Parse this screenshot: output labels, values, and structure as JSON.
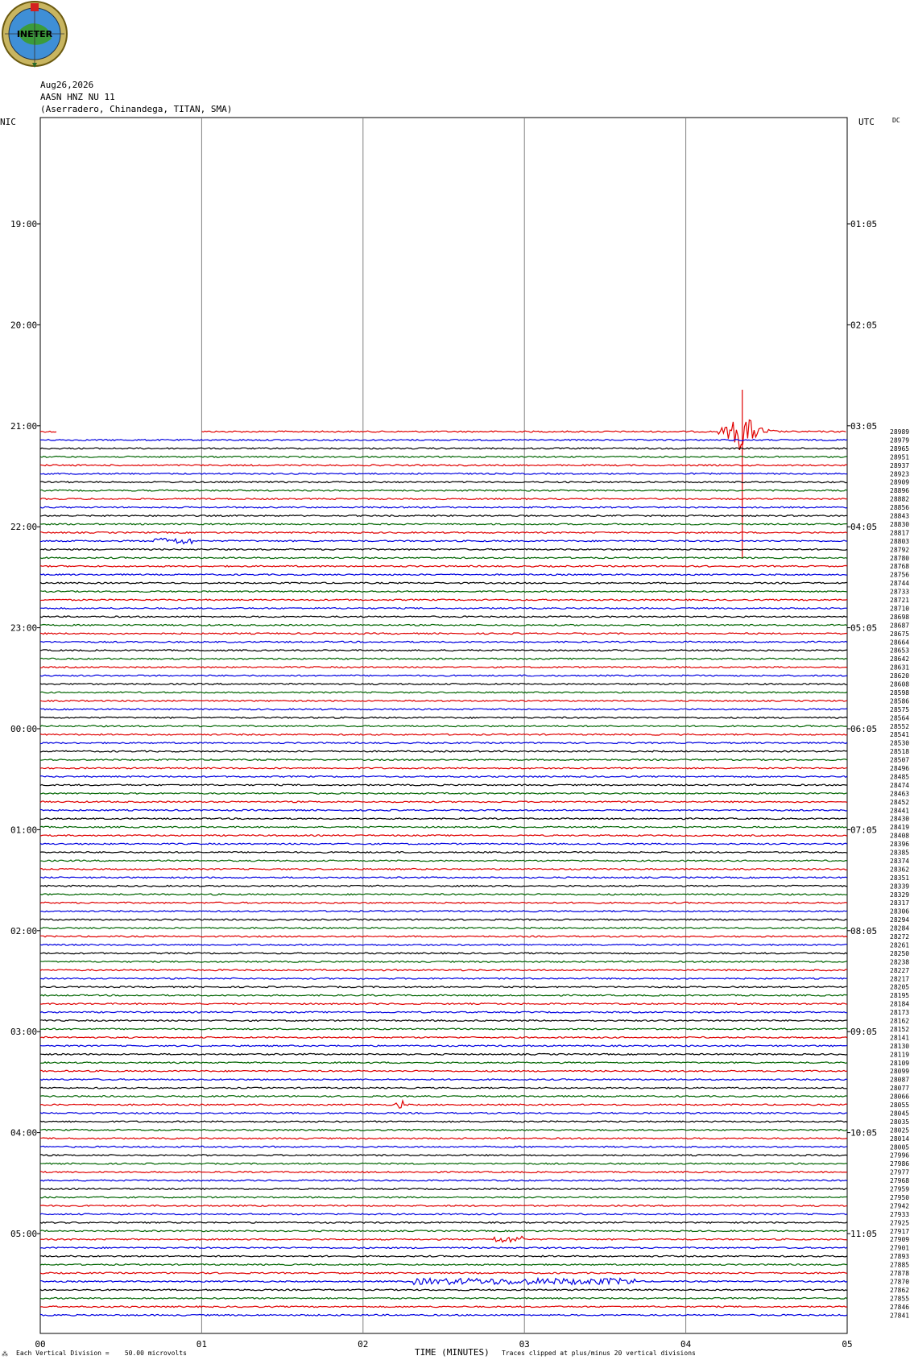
{
  "logo": {
    "text": "INETER"
  },
  "header": {
    "date": "Aug26,2026",
    "channel": "AASN HNZ NU 11",
    "location": "(Aserradero, Chinandega, TITAN, SMA)",
    "left_zone": "NIC",
    "right_zone": "UTC",
    "dc_label": "DC"
  },
  "footer": {
    "scale_note": "Each Vertical Division =    50.00 microvolts",
    "xlabel": "TIME (MINUTES)",
    "clip_note": "Traces clipped at plus/minus 20 vertical divisions"
  },
  "colors": {
    "red": "#e00000",
    "blue": "#0000e0",
    "black": "#000000",
    "green": "#006400"
  },
  "chart_data": {
    "type": "seismogram-helicorder",
    "x_ticks": [
      "00",
      "01",
      "02",
      "03",
      "04",
      "05"
    ],
    "xlim": [
      0,
      5
    ],
    "xlabel": "TIME (MINUTES)",
    "left_time_labels": [
      "19:00",
      "20:00",
      "21:00",
      "22:00",
      "23:00",
      "00:00",
      "01:00",
      "02:00",
      "03:00",
      "04:00",
      "05:00"
    ],
    "right_time_labels": [
      "01:05",
      "02:05",
      "03:05",
      "04:05",
      "05:05",
      "06:05",
      "07:05",
      "08:05",
      "09:05",
      "10:05",
      "11:05"
    ],
    "trace_color_cycle": [
      "red",
      "blue",
      "black",
      "green"
    ],
    "trace_labels": [
      "28989",
      "28979",
      "28965",
      "28951",
      "28937",
      "28923",
      "28909",
      "28896",
      "28882",
      "28856",
      "28843",
      "28830",
      "28817",
      "28803",
      "28792",
      "28780",
      "28768",
      "28756",
      "28744",
      "28733",
      "28721",
      "28710",
      "28698",
      "28687",
      "28675",
      "28664",
      "28653",
      "28642",
      "28631",
      "28620",
      "28608",
      "28598",
      "28586",
      "28575",
      "28564",
      "28552",
      "28541",
      "28530",
      "28518",
      "28507",
      "28496",
      "28485",
      "28474",
      "28463",
      "28452",
      "28441",
      "28430",
      "28419",
      "28408",
      "28396",
      "28385",
      "28374",
      "28362",
      "28351",
      "28339",
      "28329",
      "28317",
      "28306",
      "28294",
      "28284",
      "28272",
      "28261",
      "28250",
      "28238",
      "28227",
      "28217",
      "28205",
      "28195",
      "28184",
      "28173",
      "28162",
      "28152",
      "28141",
      "28130",
      "28119",
      "28109",
      "28099",
      "28087",
      "28077",
      "28066",
      "28055",
      "28045",
      "28035",
      "28025",
      "28014",
      "28005",
      "27996",
      "27986",
      "27977",
      "27968",
      "27959",
      "27950",
      "27942",
      "27933",
      "27925",
      "27917",
      "27909",
      "27901",
      "27893",
      "27885",
      "27878",
      "27870",
      "27862",
      "27855",
      "27846",
      "27841"
    ],
    "first_trace_segments": [
      [
        0.0,
        0.1
      ],
      [
        1.0,
        5.0
      ]
    ],
    "events": [
      {
        "trace": 0,
        "start_min": 4.2,
        "end_min": 4.6,
        "peak_min": 4.35,
        "type": "earthquake"
      },
      {
        "trace": 13,
        "start_min": 0.7,
        "end_min": 0.95,
        "type": "noise-burst"
      },
      {
        "trace": 80,
        "start_min": 2.2,
        "end_min": 2.25,
        "type": "spike"
      },
      {
        "trace": 96,
        "start_min": 2.8,
        "end_min": 3.0,
        "type": "noise-burst"
      },
      {
        "trace": 101,
        "start_min": 2.3,
        "end_min": 3.7,
        "type": "noise-burst"
      }
    ],
    "scale": "50.00 microvolts per vertical division",
    "clip": "plus/minus 20 vertical divisions"
  }
}
